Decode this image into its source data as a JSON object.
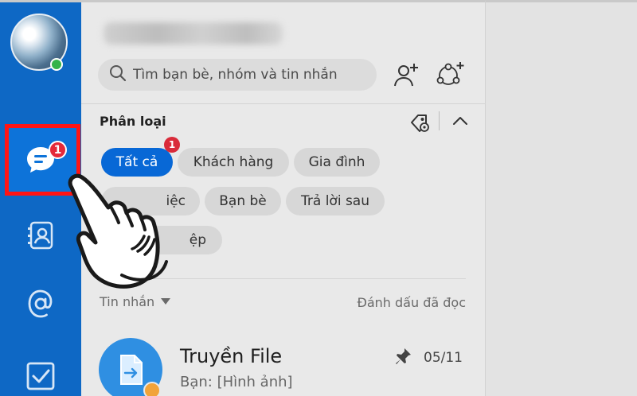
{
  "sidebar": {
    "nav": [
      {
        "icon": "chat-bubble-icon",
        "badge": "1"
      },
      {
        "icon": "contacts-icon"
      },
      {
        "icon": "at-sign-icon"
      },
      {
        "icon": "todo-checkbox-icon"
      }
    ],
    "online_color": "#35b34a",
    "accent": "#0e68c5",
    "highlight": "#ff1414"
  },
  "search": {
    "placeholder": "Tìm bạn bè, nhóm và tin nhắn"
  },
  "actions": {
    "add_friend_icon": "add-friend-icon",
    "create_group_icon": "create-group-icon"
  },
  "category": {
    "title": "Phân loại",
    "tag_icon": "tag-settings-icon",
    "collapse_icon": "chevron-up-icon",
    "chips": [
      {
        "label": "Tất cả",
        "active": true,
        "badge": "1"
      },
      {
        "label": "Khách hàng"
      },
      {
        "label": "Gia đình"
      },
      {
        "label": "iệc"
      },
      {
        "label": "Bạn bè"
      },
      {
        "label": "Trả lời sau"
      },
      {
        "label": "ệp"
      }
    ]
  },
  "list": {
    "filter_label": "Tin nhắn",
    "mark_read": "Đánh dấu đã đọc",
    "conversations": [
      {
        "name": "Truyền File",
        "preview": "Bạn: [Hình ảnh]",
        "date": "05/11",
        "pinned": true
      }
    ]
  }
}
